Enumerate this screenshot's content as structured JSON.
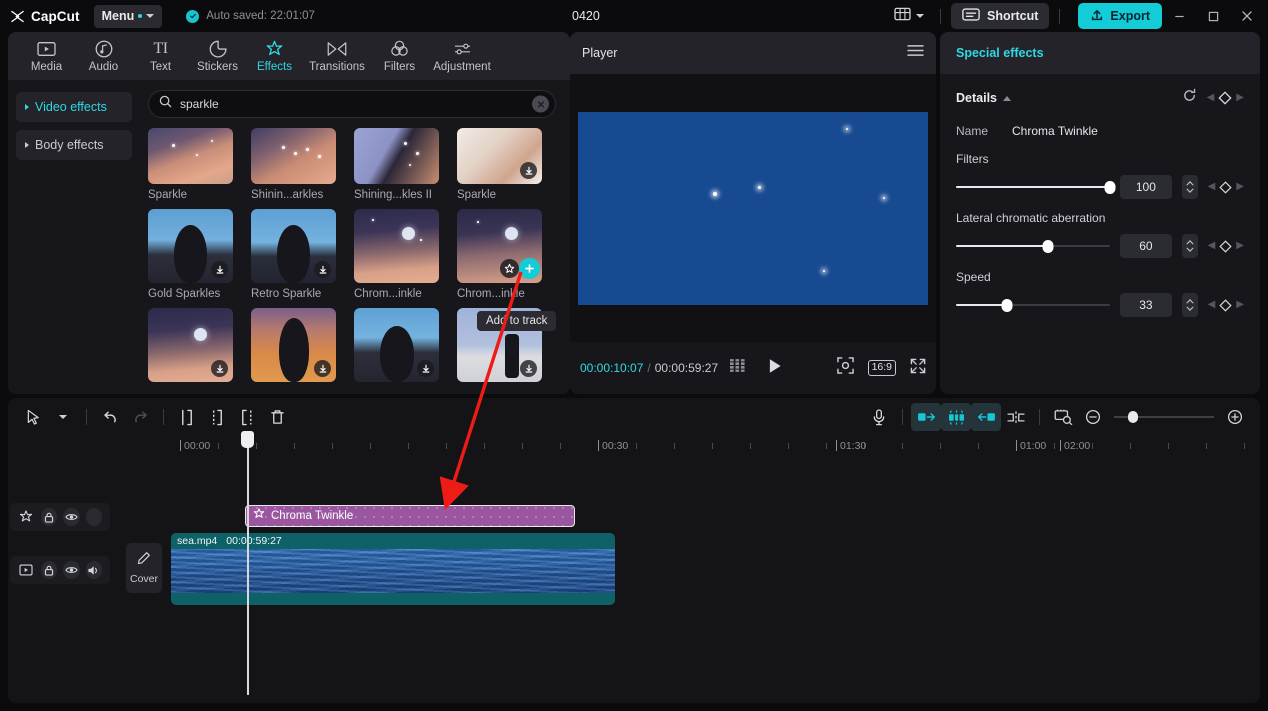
{
  "titlebar": {
    "brand": "CapCut",
    "menu_label": "Menu",
    "autosave_text": "Auto saved: 22:01:07",
    "project_title": "0420",
    "shortcut_label": "Shortcut",
    "export_label": "Export",
    "icons": {
      "logo": "capcut-logo-icon",
      "check": "check-circle-icon",
      "layout": "layout-icon",
      "layout_caret": "chevron-down-icon",
      "shortcut": "keyboard-icon",
      "export": "upload-icon",
      "minimize": "minimize-icon",
      "maximize": "maximize-icon",
      "close": "close-icon"
    }
  },
  "nav_tabs": [
    {
      "label": "Media",
      "icon": "media-icon",
      "active": false
    },
    {
      "label": "Audio",
      "icon": "audio-icon",
      "active": false
    },
    {
      "label": "Text",
      "icon": "text-icon",
      "active": false
    },
    {
      "label": "Stickers",
      "icon": "stickers-icon",
      "active": false
    },
    {
      "label": "Effects",
      "icon": "effects-icon",
      "active": true
    },
    {
      "label": "Transitions",
      "icon": "transitions-icon",
      "active": false
    },
    {
      "label": "Filters",
      "icon": "filters-icon",
      "active": false
    },
    {
      "label": "Adjustment",
      "icon": "adjustment-icon",
      "active": false
    }
  ],
  "categories": [
    {
      "label": "Video effects",
      "active": true
    },
    {
      "label": "Body effects",
      "active": false
    }
  ],
  "search": {
    "value": "sparkle",
    "placeholder": "Search",
    "icon": "search-icon",
    "clear_icon": "close-icon"
  },
  "effects_grid": [
    {
      "label": "Sparkle",
      "art": "art-sparkle1",
      "badge": "none"
    },
    {
      "label": "Shinin...arkles",
      "art": "art-sparkle2",
      "badge": "none"
    },
    {
      "label": "Shining...kles II",
      "art": "art-sparkle3",
      "badge": "none"
    },
    {
      "label": "Sparkle",
      "art": "art-sparkle4",
      "badge": "download"
    },
    {
      "label": "Gold Sparkles",
      "art": "art-gold",
      "badge": "download"
    },
    {
      "label": "Retro Sparkle",
      "art": "art-retro",
      "badge": "download"
    },
    {
      "label": "Chrom...inkle",
      "art": "art-chroma",
      "badge": "none"
    },
    {
      "label": "Chrom...inkle",
      "art": "art-moon",
      "badge": "hover"
    },
    {
      "label": "",
      "art": "art-chroma",
      "badge": "download"
    },
    {
      "label": "",
      "art": "art-sunset",
      "badge": "download"
    },
    {
      "label": "",
      "art": "art-person",
      "badge": "download"
    },
    {
      "label": "",
      "art": "art-beach",
      "badge": "download"
    }
  ],
  "tooltip": {
    "text": "Add to track"
  },
  "player": {
    "title": "Player",
    "menu_icon": "hamburger-icon",
    "current_time": "00:00:10:07",
    "separator": "/",
    "total_time": "00:00:59:27",
    "frames_icon": "frames-icon",
    "play_icon": "play-icon",
    "fit_icon": "fit-screen-icon",
    "ratio_label": "16:9",
    "fullscreen_icon": "fullscreen-icon"
  },
  "inspector": {
    "panel_title": "Special effects",
    "details_label": "Details",
    "collapse_icon": "chevron-up-icon",
    "reset_icon": "reset-icon",
    "keyframe_icon": "keyframe-diamond-icon",
    "name_label": "Name",
    "name_value": "Chroma Twinkle",
    "params": [
      {
        "label": "Filters",
        "value": "100",
        "percent": 100
      },
      {
        "label": "Lateral chromatic aberration",
        "value": "60",
        "percent": 60
      },
      {
        "label": "Speed",
        "value": "33",
        "percent": 33
      }
    ]
  },
  "timeline": {
    "tools_left": [
      {
        "name": "select-tool",
        "icon": "cursor-icon"
      },
      {
        "name": "select-dropdown",
        "icon": "chevron-down-icon"
      },
      {
        "name": "undo-button",
        "icon": "undo-icon"
      },
      {
        "name": "redo-button",
        "icon": "redo-icon"
      },
      {
        "name": "split-button",
        "icon": "split-icon"
      },
      {
        "name": "trim-left-button",
        "icon": "trim-left-icon"
      },
      {
        "name": "trim-right-button",
        "icon": "trim-right-icon"
      },
      {
        "name": "delete-button",
        "icon": "trash-icon"
      }
    ],
    "tools_right": [
      {
        "name": "record-voiceover-button",
        "icon": "microphone-icon",
        "active": false
      },
      {
        "name": "mirror-button",
        "icon": "mirror-icon",
        "active": true
      },
      {
        "name": "freeze-button",
        "icon": "freeze-icon",
        "active": true
      },
      {
        "name": "reverse-button",
        "icon": "reverse-icon",
        "active": true
      },
      {
        "name": "split-clip-button",
        "icon": "split-clip-icon",
        "active": false
      },
      {
        "name": "crop-button",
        "icon": "crop-icon",
        "active": false
      },
      {
        "name": "zoom-out-button",
        "icon": "zoom-out-icon",
        "active": false
      },
      {
        "name": "zoom-in-button",
        "icon": "zoom-in-icon",
        "active": false
      }
    ],
    "ruler_labels": [
      "00:00",
      "00:30",
      "01:00",
      "01:30",
      "02:00"
    ],
    "cover_label": "Cover",
    "cover_icon": "pencil-icon",
    "effect_track": {
      "icons": [
        "effects-star-icon",
        "lock-icon",
        "eye-icon"
      ],
      "clip_label": "Chroma Twinkle",
      "clip_icon": "effects-star-icon"
    },
    "video_track": {
      "icons": [
        "video-icon",
        "lock-icon",
        "eye-icon",
        "speaker-icon"
      ],
      "clip_name": "sea.mp4",
      "clip_duration": "00:00:59:27"
    }
  },
  "colors": {
    "accent": "#14cbd8",
    "accent_text": "#2fd8e4",
    "effect_clip": "#9a57a0",
    "video_clip": "#0f6168",
    "arrow": "#ee1c17",
    "panel_bg": "#17171b",
    "window_bg": "#0b0b0d"
  }
}
